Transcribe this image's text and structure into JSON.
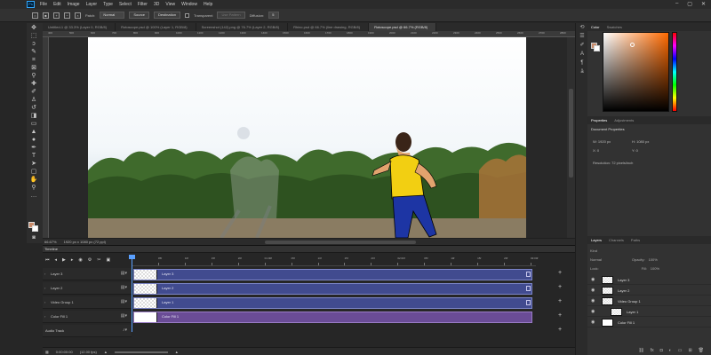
{
  "app_logo": "Ps",
  "menu": [
    "File",
    "Edit",
    "Image",
    "Layer",
    "Type",
    "Select",
    "Filter",
    "3D",
    "View",
    "Window",
    "Help"
  ],
  "window_controls": [
    "–",
    "▢",
    "✕"
  ],
  "options_bar": {
    "patch_label": "Patch:",
    "patch_value": "Normal",
    "source_button": "Source",
    "destination_button": "Destination",
    "transparent_label": "Transparent",
    "use_pattern_button": "Use Pattern",
    "diffusion_label": "Diffusion:",
    "diffusion_value": "5"
  },
  "doc_tabs": [
    "Untitled-1 @ 33.3% (Layer 0, RGB/8)",
    "Rotoscope.psd @ 100% (Layer 1, RGB/8)",
    "Screenshot (142).png @ 76.7% (Layer 2, RGB/8)",
    "Rhino.psd @ 66.7% (line drawing, RGB/8)",
    "Rotoscope.psd @ 66.7% (RGB/8)"
  ],
  "active_tab_index": 4,
  "ruler_labels": [
    "400",
    "500",
    "600",
    "700",
    "800",
    "900",
    "1000",
    "1100",
    "1200",
    "1300",
    "1400",
    "1500",
    "1600",
    "1700",
    "1800",
    "1900",
    "2000",
    "2100",
    "2200",
    "2300",
    "2400",
    "2500",
    "2600",
    "2700",
    "2800"
  ],
  "status": {
    "zoom": "66.67%",
    "doc_info": "1920 px x 1080 px (72 ppi)"
  },
  "timeline": {
    "title": "Timeline",
    "ticks": [
      "00",
      "05f",
      "10f",
      "15f",
      "20f",
      "01:00f",
      "05f",
      "10f",
      "15f",
      "20f",
      "02:00f",
      "05f",
      "10f",
      "15f",
      "20f",
      "03:00f"
    ],
    "tracks": [
      {
        "name": "Layer 3",
        "clip": "Layer 3",
        "kind": "video"
      },
      {
        "name": "Layer 2",
        "clip": "Layer 2",
        "kind": "video"
      },
      {
        "name": "Video Group 1",
        "clip": "Layer 1",
        "kind": "video"
      },
      {
        "name": "Color Fill 1",
        "clip": "Color Fill 1",
        "kind": "fill"
      }
    ],
    "audio_track": "Audio Track",
    "timecode": "0:00:00:00",
    "fps": "(12.00 fps)"
  },
  "color_panel": {
    "tabs": [
      "Color",
      "Swatches"
    ],
    "fg_color": "#c98b6a",
    "bg_color": "#ffffff"
  },
  "properties": {
    "tabs": [
      "Properties",
      "Adjustments"
    ],
    "heading": "Document Properties",
    "w": "W: 1920 px",
    "h": "H: 1080 px",
    "x": "X: 0",
    "y": "Y: 0",
    "resolution": "Resolution: 72 pixels/inch"
  },
  "layers_panel": {
    "tabs": [
      "Layers",
      "Channels",
      "Paths"
    ],
    "kind_label": "Kind",
    "blend_mode": "Normal",
    "opacity_label": "Opacity:",
    "opacity": "100%",
    "lock_label": "Lock:",
    "fill_label": "Fill:",
    "fill": "100%",
    "layers": [
      {
        "name": "Layer 3",
        "indent": 0
      },
      {
        "name": "Layer 2",
        "indent": 0
      },
      {
        "name": "Video Group 1",
        "indent": 0
      },
      {
        "name": "Layer 1",
        "indent": 1
      },
      {
        "name": "Color Fill 1",
        "indent": 0
      }
    ]
  }
}
